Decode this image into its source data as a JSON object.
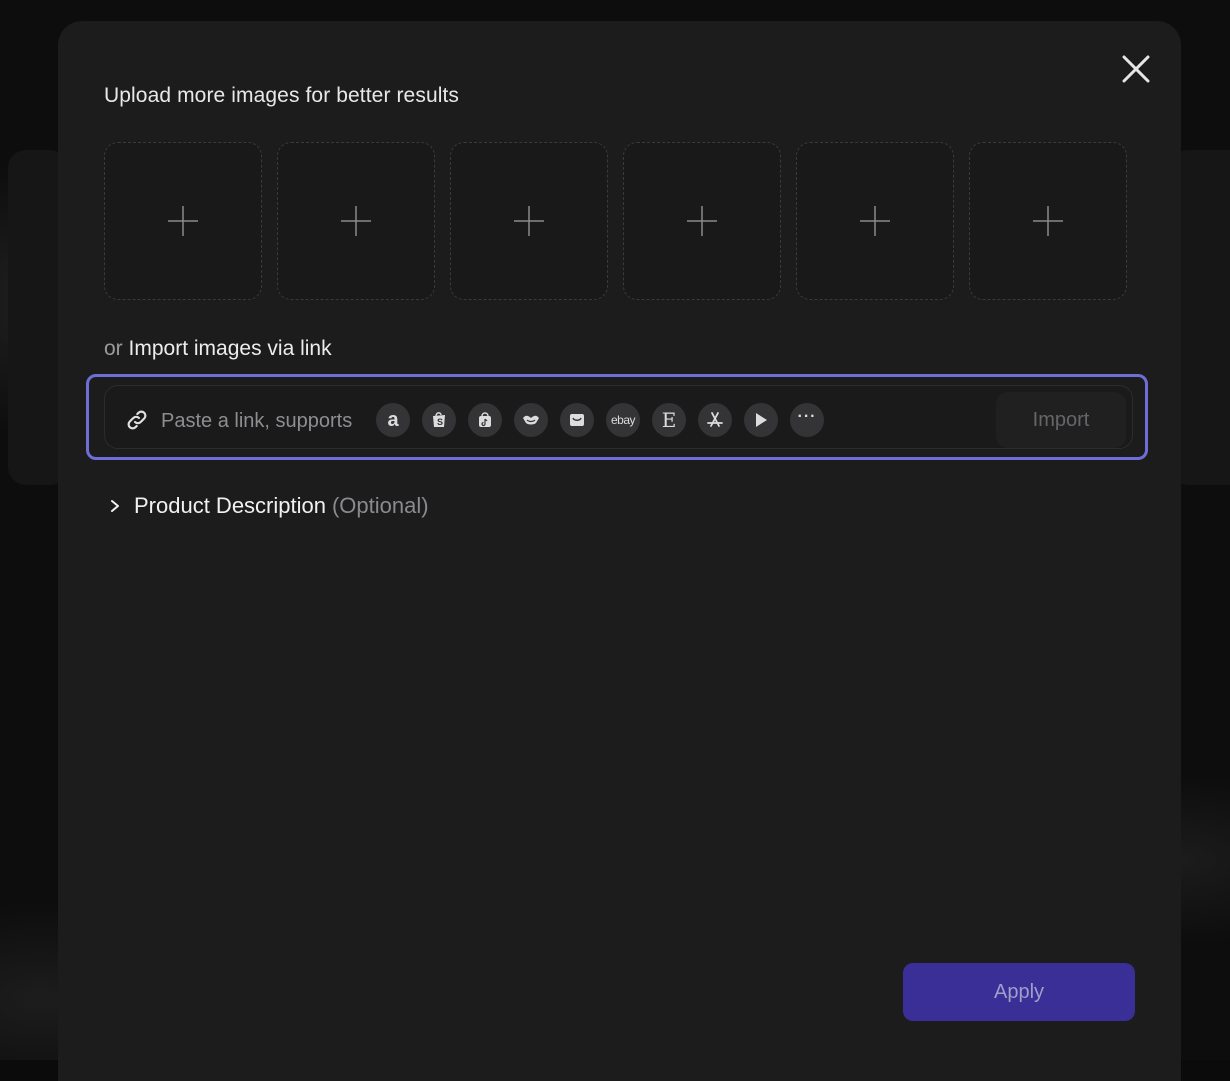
{
  "dialog": {
    "upload_title": "Upload more images for better results",
    "upload_slot_count": 6,
    "import_prefix": "or",
    "import_title": "Import images via link",
    "link_placeholder": "Paste a link, supports",
    "platform_icons": [
      {
        "name": "amazon-icon",
        "glyph": "a"
      },
      {
        "name": "shopify-icon",
        "glyph": ""
      },
      {
        "name": "tiktok-shop-icon",
        "glyph": ""
      },
      {
        "name": "handshake-icon",
        "glyph": ""
      },
      {
        "name": "shopping-bag-icon",
        "glyph": ""
      },
      {
        "name": "ebay-icon",
        "glyph": "ebay"
      },
      {
        "name": "etsy-icon",
        "glyph": "E"
      },
      {
        "name": "app-store-icon",
        "glyph": ""
      },
      {
        "name": "google-play-icon",
        "glyph": ""
      },
      {
        "name": "more-icon",
        "glyph": "···"
      }
    ],
    "import_button": "Import",
    "description_title": "Product Description",
    "description_optional": "(Optional)",
    "apply_button": "Apply"
  },
  "colors": {
    "accent_border": "#6f6ed6",
    "apply_bg": "#3a2f97",
    "modal_bg": "#1c1c1d"
  }
}
